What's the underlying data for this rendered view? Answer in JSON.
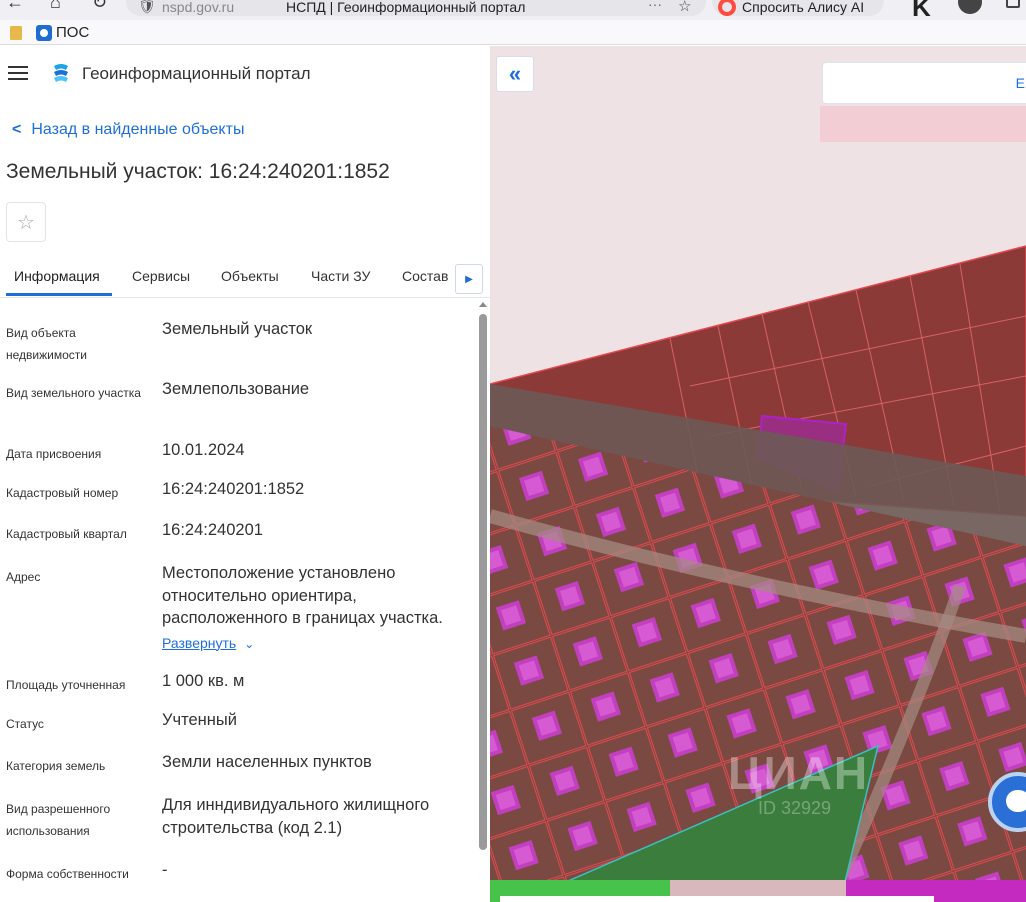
{
  "browser": {
    "domain": "nspd.gov.ru",
    "tab_title": "НСПД | Геоинформационный портал",
    "more": "···",
    "alice_label": "Спросить Алису AI"
  },
  "bookmarks": {
    "item_label": "ПОС"
  },
  "header": {
    "portal_title": "Геоинформационный портал"
  },
  "back_link": "Назад в найденные объекты",
  "page_title": "Земельный участок: 16:24:240201:1852",
  "tabs": [
    {
      "label": "Информация",
      "active": true
    },
    {
      "label": "Сервисы",
      "active": false
    },
    {
      "label": "Объекты",
      "active": false
    },
    {
      "label": "Части ЗУ",
      "active": false
    },
    {
      "label": "Состав",
      "active": false
    }
  ],
  "properties": [
    {
      "label": "Вид объекта недвижимости",
      "value": "Земельный участок"
    },
    {
      "label": "Вид земельного участка",
      "value": "Землепользование"
    },
    {
      "label": "Дата присвоения",
      "value": "10.01.2024"
    },
    {
      "label": "Кадастровый номер",
      "value": "16:24:240201:1852"
    },
    {
      "label": "Кадастровый квартал",
      "value": "16:24:240201"
    },
    {
      "label": "Адрес",
      "value": "Местоположение установлено относительно ориентира, расположенного в границах участка.",
      "expand_label": "Развернуть"
    },
    {
      "label": "Площадь уточненная",
      "value": "1 000 кв. м"
    },
    {
      "label": "Статус",
      "value": "Учтенный"
    },
    {
      "label": "Категория земель",
      "value": "Земли населенных пунктов"
    },
    {
      "label": "Вид разрешенного использования",
      "value": "Для инндивидуального жилищного строительства (код 2.1)"
    },
    {
      "label": "Форма собственности",
      "value": "-"
    }
  ],
  "map": {
    "collapse_label": "«",
    "search_cut_text": "E",
    "watermark": "ЦИАН",
    "watermark_sub": "ID 32929"
  },
  "colors": {
    "accent": "#1e6fd9",
    "parcel_fill": "#8a2a30",
    "highlight_parcel": "#a020c0",
    "house_roof": "#c040c0",
    "green_zone": "#3a8a3a"
  },
  "icons": {
    "menu": "hamburger-icon",
    "portal": "portal-logo-icon",
    "favorite": "star-icon",
    "tabs_next": "triangle-right-icon",
    "chat": "chat-bubble-icon"
  }
}
